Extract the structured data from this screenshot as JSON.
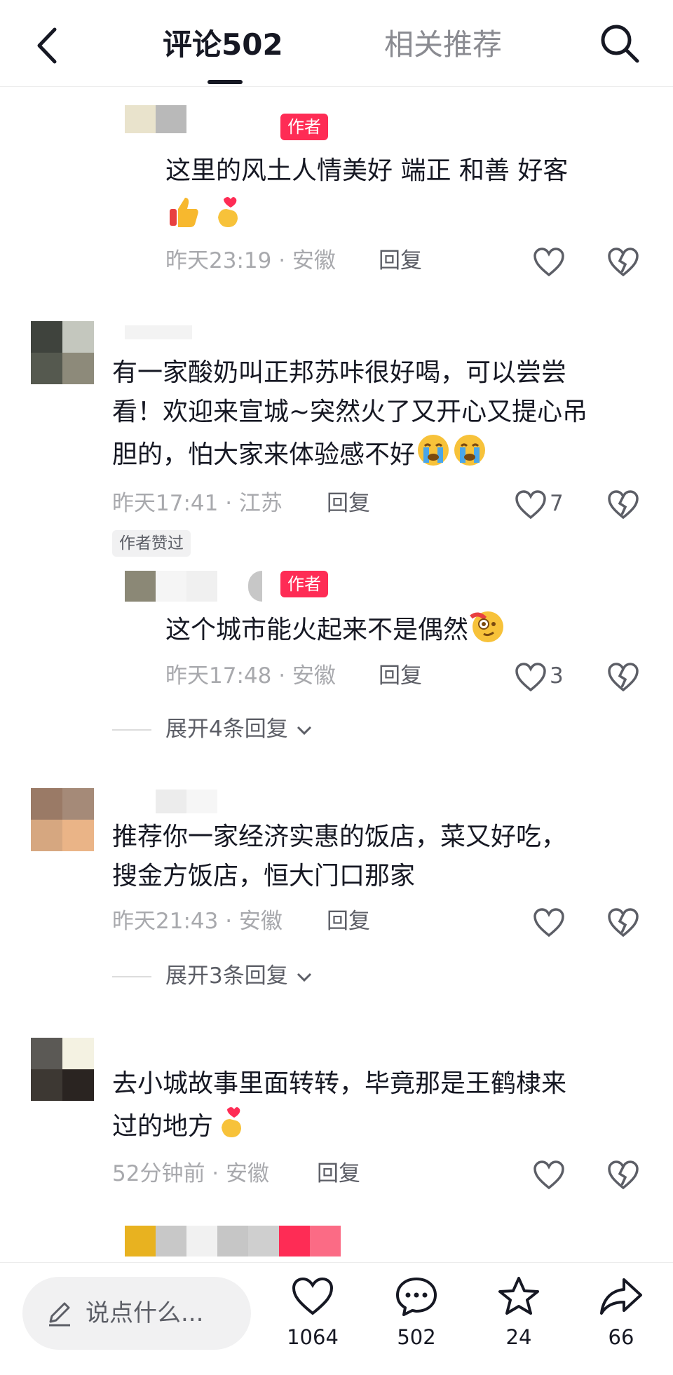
{
  "header": {
    "tab_comments": "评论502",
    "tab_related": "相关推荐"
  },
  "labels": {
    "author": "作者",
    "author_liked": "作者赞过",
    "reply": "回复"
  },
  "comments": [
    {
      "text": "这里的风土人情美好 端正 和善 好客",
      "emoji": [
        "thumbs-up",
        "finger-heart"
      ],
      "time": "昨天23:19",
      "location": "安徽"
    },
    {
      "text_lines": [
        "有一家酸奶叫正邦苏咔很好喝，可以尝尝",
        "看！欢迎来宣城~突然火了又开心又提心吊",
        "胆的，怕大家来体验感不好"
      ],
      "emoji": [
        "crying-face",
        "crying-face"
      ],
      "time": "昨天17:41",
      "location": "江苏",
      "likes": "7"
    },
    {
      "text": "这个城市能火起来不是偶然",
      "emoji": [
        "face-with-monocle"
      ],
      "time": "昨天17:48",
      "location": "安徽",
      "likes": "3",
      "expand": "展开4条回复"
    },
    {
      "text_lines": [
        "推荐你一家经济实惠的饭店，菜又好吃，",
        "搜金方饭店，恒大门口那家"
      ],
      "time": "昨天21:43",
      "location": "安徽",
      "expand": "展开3条回复"
    },
    {
      "text_lines": [
        "去小城故事里面转转，毕竟那是王鹤棣来",
        "过的地方"
      ],
      "emoji": [
        "finger-heart"
      ],
      "time": "52分钟前",
      "location": "安徽"
    }
  ],
  "bottom": {
    "placeholder": "说点什么...",
    "likes": "1064",
    "comments": "502",
    "favorites": "24",
    "shares": "66"
  },
  "colors": {
    "accent": "#fe2c55",
    "text": "#161823",
    "muted": "#a8a9ad"
  }
}
